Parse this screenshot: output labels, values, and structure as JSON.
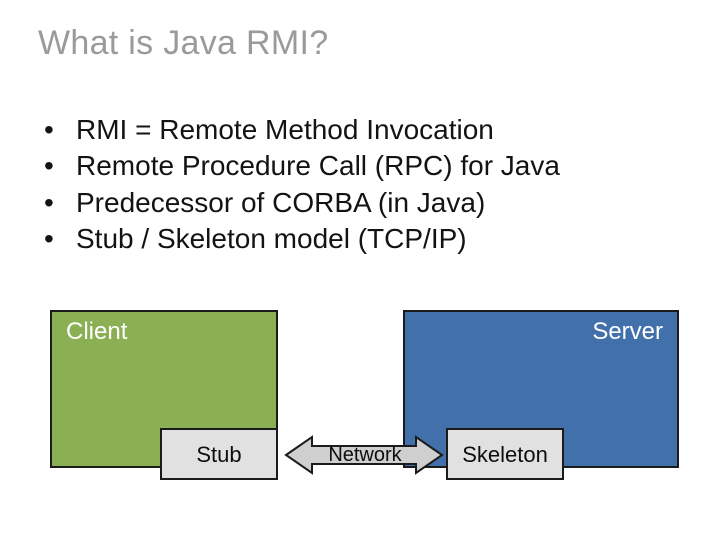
{
  "title": "What is Java RMI?",
  "bullets": [
    "RMI = Remote Method Invocation",
    "Remote Procedure Call (RPC) for Java",
    "Predecessor of CORBA (in Java)",
    "Stub / Skeleton model (TCP/IP)"
  ],
  "diagram": {
    "client": "Client",
    "server": "Server",
    "stub": "Stub",
    "skeleton": "Skeleton",
    "network": "Network"
  },
  "colors": {
    "client_fill": "#8bb054",
    "server_fill": "#4270aa",
    "small_fill": "#e1e1e1",
    "arrow_fill": "#cfcfcf",
    "stroke": "#1b1b1b"
  }
}
